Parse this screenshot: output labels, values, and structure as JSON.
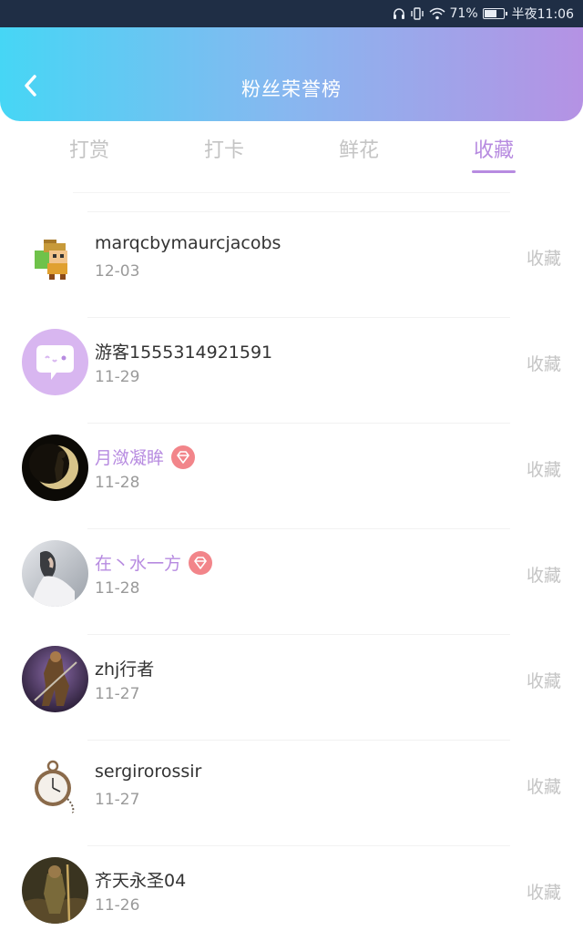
{
  "status_bar": {
    "battery_percent": "71%",
    "battery_level": 0.71,
    "time": "半夜11:06",
    "icons": [
      "headphones-icon",
      "vibrate-icon",
      "wifi-icon",
      "battery-icon"
    ]
  },
  "header": {
    "title": "粉丝荣誉榜",
    "back_icon": "chevron-left-icon",
    "gradient_colors": [
      "#46d6f5",
      "#86b8f0",
      "#b592e4"
    ]
  },
  "tabs": [
    {
      "label": "打赏",
      "active": false
    },
    {
      "label": "打卡",
      "active": false
    },
    {
      "label": "鲜花",
      "active": false
    },
    {
      "label": "收藏",
      "active": true
    }
  ],
  "accent_color": "#b78be0",
  "fans": [
    {
      "name": "marqcbymaurcjacobs",
      "date": "12-03",
      "action": "收藏",
      "vip": false,
      "avatar": "pixel-character-avatar"
    },
    {
      "name": "游客1555314921591",
      "date": "11-29",
      "action": "收藏",
      "vip": false,
      "avatar": "chat-bubble-avatar"
    },
    {
      "name": "月潋凝眸",
      "date": "11-28",
      "action": "收藏",
      "vip": true,
      "avatar": "moon-silhouette-avatar"
    },
    {
      "name": "在丶水一方",
      "date": "11-28",
      "action": "收藏",
      "vip": true,
      "avatar": "foggy-figure-avatar"
    },
    {
      "name": "zhj行者",
      "date": "11-27",
      "action": "收藏",
      "vip": false,
      "avatar": "warrior-avatar"
    },
    {
      "name": "sergirorossir",
      "date": "11-27",
      "action": "收藏",
      "vip": false,
      "avatar": "pocket-watch-avatar"
    },
    {
      "name": "齐天永圣04",
      "date": "11-26",
      "action": "收藏",
      "vip": false,
      "avatar": "monkey-king-avatar"
    }
  ]
}
